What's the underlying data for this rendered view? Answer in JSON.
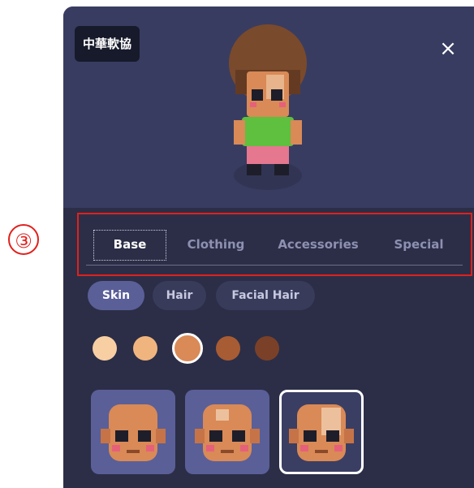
{
  "annotation": {
    "number_marker": "③"
  },
  "header": {
    "badge_text": "中華軟協",
    "close_glyph": "×"
  },
  "tabs": [
    {
      "label": "Base",
      "active": true
    },
    {
      "label": "Clothing",
      "active": false
    },
    {
      "label": "Accessories",
      "active": false
    },
    {
      "label": "Special",
      "active": false
    }
  ],
  "subtabs": [
    {
      "label": "Skin",
      "active": true
    },
    {
      "label": "Hair",
      "active": false
    },
    {
      "label": "Facial Hair",
      "active": false
    }
  ],
  "skin_colors": [
    {
      "hex": "#f7cfa3",
      "selected": false
    },
    {
      "hex": "#f0b57e",
      "selected": false
    },
    {
      "hex": "#d98a57",
      "selected": true
    },
    {
      "hex": "#a85c33",
      "selected": false
    },
    {
      "hex": "#7a4128",
      "selected": false
    }
  ],
  "skin_options": [
    {
      "id": "plain",
      "selected": false
    },
    {
      "id": "spotted-light",
      "selected": false
    },
    {
      "id": "spotted-heavy",
      "selected": true
    }
  ],
  "colors": {
    "panel_bg": "#2c2e47",
    "header_bg": "#393c61",
    "highlight_red": "#e0211d",
    "active_pill": "#5a5f98"
  }
}
